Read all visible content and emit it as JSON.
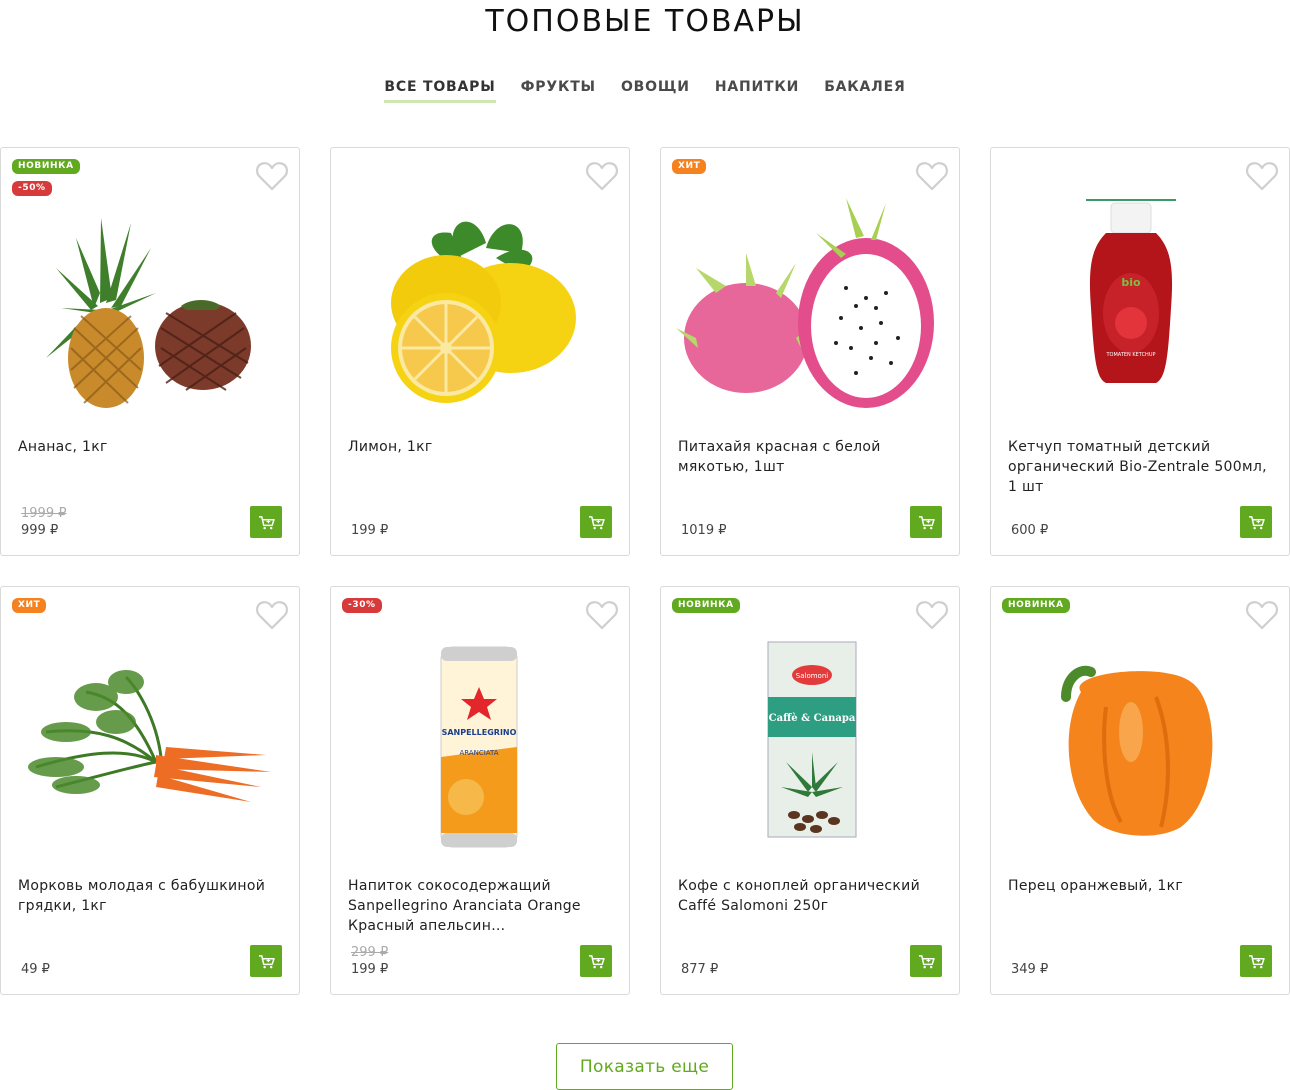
{
  "page": {
    "title": "ТОПОВЫЕ ТОВАРЫ"
  },
  "tabs": [
    {
      "label": "ВСЕ ТОВАРЫ",
      "active": true
    },
    {
      "label": "ФРУКТЫ"
    },
    {
      "label": "ОВОЩИ"
    },
    {
      "label": "НАПИТКИ"
    },
    {
      "label": "БАКАЛЕЯ"
    }
  ],
  "colors": {
    "green": "#61a91f",
    "new_badge": "#61a91f",
    "hit_badge": "#f5821f",
    "sale_badge": "#d63a3a"
  },
  "products": [
    {
      "name": "Ананас, 1кг",
      "badges": [
        "НОВИНКА",
        "-50%"
      ],
      "old_price": "1999 ₽",
      "price": "999 ₽",
      "image": "pineapple"
    },
    {
      "name": "Лимон, 1кг",
      "badges": [],
      "old_price": "",
      "price": "199 ₽",
      "image": "lemon"
    },
    {
      "name": "Питахайя красная с белой мякотью, 1шт",
      "badges": [
        "ХИТ"
      ],
      "old_price": "",
      "price": "1019 ₽",
      "image": "pitahaya"
    },
    {
      "name": "Кетчуп томатный детский органический Bio-Zentrale 500мл, 1 шт",
      "badges": [],
      "old_price": "",
      "price": "600 ₽",
      "image": "ketchup"
    },
    {
      "name": "Морковь молодая с бабушкиной грядки, 1кг",
      "badges": [
        "ХИТ"
      ],
      "old_price": "",
      "price": "49 ₽",
      "image": "carrot"
    },
    {
      "name": "Напиток сокосодержащий Sanpellegrino Aranciata Orange Красный апельсин безалкогольн...",
      "badges": [
        "-30%"
      ],
      "old_price": "299 ₽",
      "price": "199 ₽",
      "image": "can"
    },
    {
      "name": "Кофе с коноплей органический Caffé Salomoni 250г",
      "badges": [
        "НОВИНКА"
      ],
      "old_price": "",
      "price": "877 ₽",
      "image": "coffee"
    },
    {
      "name": "Перец оранжевый, 1кг",
      "badges": [
        "НОВИНКА"
      ],
      "old_price": "",
      "price": "349 ₽",
      "image": "pepper"
    }
  ],
  "labels": {
    "ketchup_brand": "bio",
    "ketchup_text": "TOMATEN KETCHUP",
    "can_brand": "SANPELLEGRINO",
    "can_flavor": "ARANCIATA",
    "coffee_brand": "Salomoni",
    "coffee_title": "Caffè & Canapa"
  },
  "show_more": "Показать еще"
}
